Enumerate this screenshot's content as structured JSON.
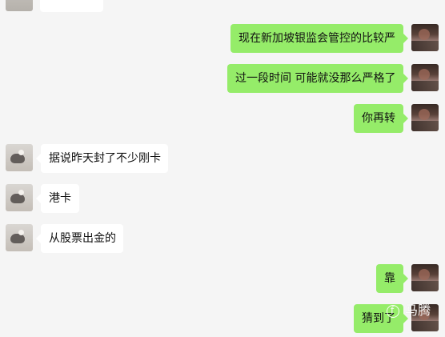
{
  "messages": [
    {
      "side": "right",
      "text": "现在新加坡银监会管控的比较严"
    },
    {
      "side": "right",
      "text": "过一段时间 可能就没那么严格了"
    },
    {
      "side": "right",
      "text": "你再转"
    },
    {
      "side": "left",
      "text": "据说昨天封了不少刚卡"
    },
    {
      "side": "left",
      "text": "港卡"
    },
    {
      "side": "left",
      "text": "从股票出金的"
    },
    {
      "side": "right",
      "text": "靠"
    },
    {
      "side": "right",
      "text": "猜到了"
    }
  ],
  "watermark": {
    "text": "马腾",
    "icon": "watermark-logo-icon"
  }
}
